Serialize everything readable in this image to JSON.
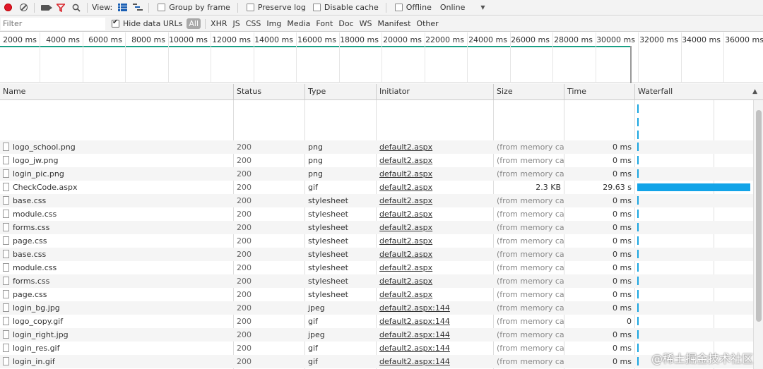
{
  "toolbar": {
    "record_icon": "record-icon",
    "clear_icon": "clear-icon",
    "capture_icon": "camera-icon",
    "filter_icon": "filter-icon",
    "search_icon": "search-icon",
    "view_label": "View:",
    "group_by_frame": "Group by frame",
    "preserve_log": "Preserve log",
    "disable_cache": "Disable cache",
    "offline": "Offline",
    "throttle": "Online"
  },
  "filterbar": {
    "placeholder": "Filter",
    "hide_data_urls": "Hide data URLs",
    "types": [
      "All",
      "XHR",
      "JS",
      "CSS",
      "Img",
      "Media",
      "Font",
      "Doc",
      "WS",
      "Manifest",
      "Other"
    ]
  },
  "overview": {
    "ticks": [
      "2000 ms",
      "4000 ms",
      "6000 ms",
      "8000 ms",
      "10000 ms",
      "12000 ms",
      "14000 ms",
      "16000 ms",
      "18000 ms",
      "20000 ms",
      "22000 ms",
      "24000 ms",
      "26000 ms",
      "28000 ms",
      "30000 ms",
      "32000 ms",
      "34000 ms",
      "36000 ms"
    ]
  },
  "columns": {
    "name": "Name",
    "status": "Status",
    "type": "Type",
    "initiator": "Initiator",
    "size": "Size",
    "time": "Time",
    "waterfall": "Waterfall"
  },
  "rows": [
    {
      "name": "logo_school.png",
      "status": "200",
      "type": "png",
      "initiator": "default2.aspx",
      "size": "(from memory ca...",
      "time": "0 ms"
    },
    {
      "name": "logo_jw.png",
      "status": "200",
      "type": "png",
      "initiator": "default2.aspx",
      "size": "(from memory ca...",
      "time": "0 ms"
    },
    {
      "name": "login_pic.png",
      "status": "200",
      "type": "png",
      "initiator": "default2.aspx",
      "size": "(from memory ca...",
      "time": "0 ms"
    },
    {
      "name": "CheckCode.aspx",
      "status": "200",
      "type": "gif",
      "initiator": "default2.aspx",
      "size": "2.3 KB",
      "time": "29.63 s"
    },
    {
      "name": "base.css",
      "status": "200",
      "type": "stylesheet",
      "initiator": "default2.aspx",
      "size": "(from memory ca...",
      "time": "0 ms"
    },
    {
      "name": "module.css",
      "status": "200",
      "type": "stylesheet",
      "initiator": "default2.aspx",
      "size": "(from memory ca...",
      "time": "0 ms"
    },
    {
      "name": "forms.css",
      "status": "200",
      "type": "stylesheet",
      "initiator": "default2.aspx",
      "size": "(from memory ca...",
      "time": "0 ms"
    },
    {
      "name": "page.css",
      "status": "200",
      "type": "stylesheet",
      "initiator": "default2.aspx",
      "size": "(from memory ca...",
      "time": "0 ms"
    },
    {
      "name": "base.css",
      "status": "200",
      "type": "stylesheet",
      "initiator": "default2.aspx",
      "size": "(from memory ca...",
      "time": "0 ms"
    },
    {
      "name": "module.css",
      "status": "200",
      "type": "stylesheet",
      "initiator": "default2.aspx",
      "size": "(from memory ca...",
      "time": "0 ms"
    },
    {
      "name": "forms.css",
      "status": "200",
      "type": "stylesheet",
      "initiator": "default2.aspx",
      "size": "(from memory ca...",
      "time": "0 ms"
    },
    {
      "name": "page.css",
      "status": "200",
      "type": "stylesheet",
      "initiator": "default2.aspx",
      "size": "(from memory ca...",
      "time": "0 ms"
    },
    {
      "name": "login_bg.jpg",
      "status": "200",
      "type": "jpeg",
      "initiator": "default2.aspx:144",
      "size": "(from memory ca...",
      "time": "0 ms"
    },
    {
      "name": "logo_copy.gif",
      "status": "200",
      "type": "gif",
      "initiator": "default2.aspx:144",
      "size": "(from memory ca...",
      "time": "0"
    },
    {
      "name": "login_right.jpg",
      "status": "200",
      "type": "jpeg",
      "initiator": "default2.aspx:144",
      "size": "(from memory ca...",
      "time": "0 ms"
    },
    {
      "name": "login_res.gif",
      "status": "200",
      "type": "gif",
      "initiator": "default2.aspx:144",
      "size": "(from memory ca...",
      "time": "0 ms"
    },
    {
      "name": "login_in.gif",
      "status": "200",
      "type": "gif",
      "initiator": "default2.aspx:144",
      "size": "(from memory ca...",
      "time": "0 ms"
    }
  ],
  "watermark": "@稀土掘金技术社区"
}
